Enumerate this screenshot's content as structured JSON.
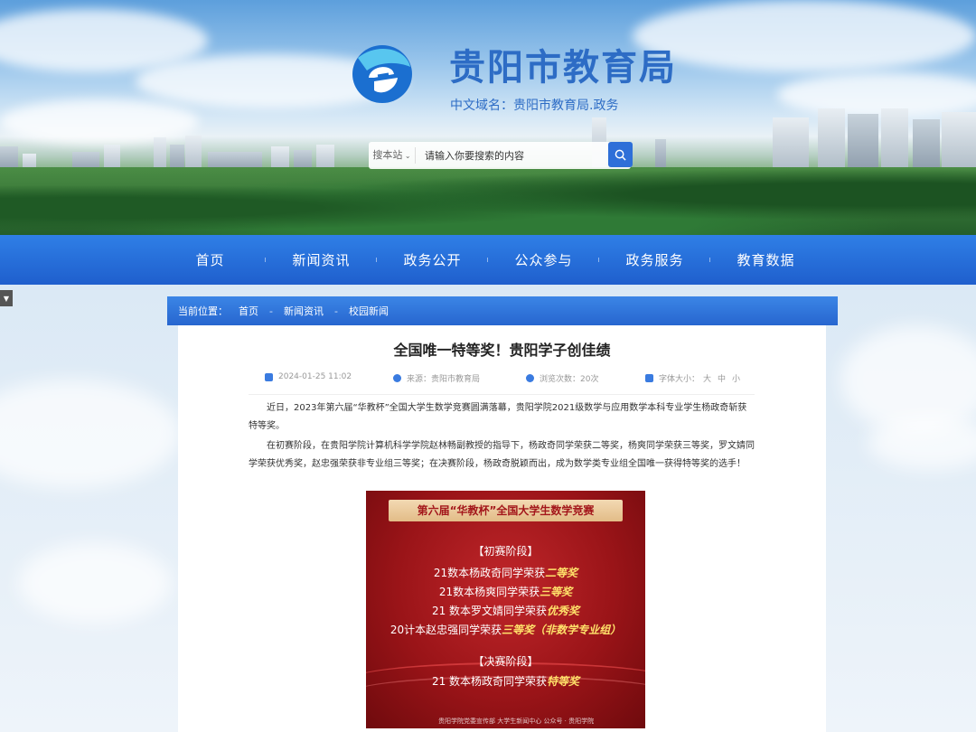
{
  "header": {
    "site_title": "贵阳市教育局",
    "domain_text": "中文域名：贵阳市教育局.政务",
    "search_scope": "搜本站",
    "search_placeholder": "请输入你要搜索的内容"
  },
  "nav": {
    "items": [
      "首页",
      "新闻资讯",
      "政务公开",
      "公众参与",
      "政务服务",
      "教育数据"
    ]
  },
  "breadcrumb": {
    "label": "当前位置：",
    "items": [
      "首页",
      "新闻资讯",
      "校园新闻"
    ],
    "sep": "-"
  },
  "article": {
    "title": "全国唯一特等奖！贵阳学子创佳绩",
    "date": "2024-01-25 11:02",
    "source": "来源：贵阳市教育局",
    "views": "浏览次数：20次",
    "font_size_label": "字体大小：",
    "font_sizes": [
      "大",
      "中",
      "小"
    ],
    "para1": "近日，2023年第六届“华教杯”全国大学生数学竞赛圆满落幕，贵阳学院2021级数学与应用数学本科专业学生杨政奇斩获特等奖。",
    "para2": "在初赛阶段，在贵阳学院计算机科学学院赵林畅副教授的指导下，杨政奇同学荣获二等奖，杨爽同学荣获三等奖，罗文婧同学荣获优秀奖，赵忠强荣获非专业组三等奖；在决赛阶段，杨政奇脱颖而出，成为数学类专业组全国唯一获得特等奖的选手！"
  },
  "poster": {
    "banner": "第六届“华教杯”全国大学生数学竞赛",
    "stage1": "【初赛阶段】",
    "l1_pre": "21数本杨政奇同学荣获",
    "l1_award": "二等奖",
    "l2_pre": "21数本杨爽同学荣获",
    "l2_award": "三等奖",
    "l3_pre": "21 数本罗文婧同学荣获",
    "l3_award": "优秀奖",
    "l4_pre": "20计本赵忠强同学荣获",
    "l4_award": "三等奖（非数学专业组）",
    "stage2": "【决赛阶段】",
    "l5_pre": "21 数本杨政奇同学荣获",
    "l5_award": "特等奖",
    "footer": "贵阳学院党委宣传部 大学生新闻中心        公众号 · 贵阳学院"
  },
  "colors": {
    "nav": "#2468d6",
    "title": "#2d6cc5",
    "poster_red": "#9a1418",
    "award_yellow": "#ffe16a"
  }
}
